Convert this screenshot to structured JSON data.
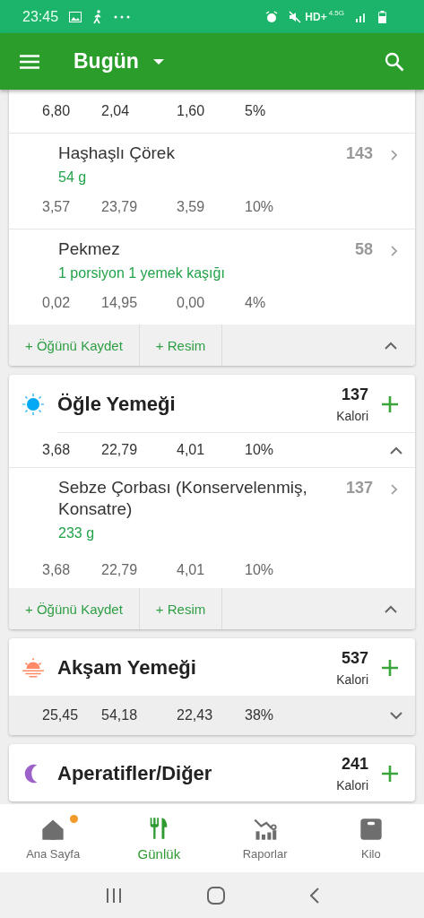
{
  "status_bar": {
    "time": "23:45",
    "network": "HD+",
    "generation": "4.5G"
  },
  "app_bar": {
    "title": "Bugün"
  },
  "meals": [
    {
      "expanded": true,
      "macros": [
        "6,80",
        "2,04",
        "1,60",
        "5%"
      ],
      "foods": [
        {
          "name": "Haşhaşlı Çörek",
          "amount": "54  g",
          "calories": "143",
          "macros": [
            "3,57",
            "23,79",
            "3,59",
            "10%"
          ]
        },
        {
          "name": "Pekmez",
          "amount": "1 porsiyon 1 yemek kaşığı",
          "calories": "58",
          "macros": [
            "0,02",
            "14,95",
            "0,00",
            "4%"
          ]
        }
      ],
      "actions": [
        "+ Öğünü Kaydet",
        "+ Resim"
      ]
    },
    {
      "name": "Öğle Yemeği",
      "kind": "sun",
      "calories": "137",
      "calories_label": "Kalori",
      "expanded": true,
      "macros": [
        "3,68",
        "22,79",
        "4,01",
        "10%"
      ],
      "foods": [
        {
          "name": "Sebze Çorbası (Konservelenmiş, Konsatre)",
          "amount": "233  g",
          "calories": "137",
          "macros": [
            "3,68",
            "22,79",
            "4,01",
            "10%"
          ]
        }
      ],
      "actions": [
        "+ Öğünü Kaydet",
        "+ Resim"
      ]
    },
    {
      "name": "Akşam Yemeği",
      "kind": "sunset",
      "calories": "537",
      "calories_label": "Kalori",
      "expanded": false,
      "macros": [
        "25,45",
        "54,18",
        "22,43",
        "38%"
      ]
    },
    {
      "name": "Aperatifler/Diğer",
      "kind": "moon",
      "calories": "241",
      "calories_label": "Kalori"
    }
  ],
  "bottom_nav": [
    {
      "label": "Ana Sayfa",
      "kind": "home",
      "selected": false,
      "badge": true
    },
    {
      "label": "Günlük",
      "kind": "cutlery",
      "selected": true,
      "badge": false
    },
    {
      "label": "Raporlar",
      "kind": "chart",
      "selected": false,
      "badge": false
    },
    {
      "label": "Kilo",
      "kind": "scale",
      "selected": false,
      "badge": false
    }
  ]
}
